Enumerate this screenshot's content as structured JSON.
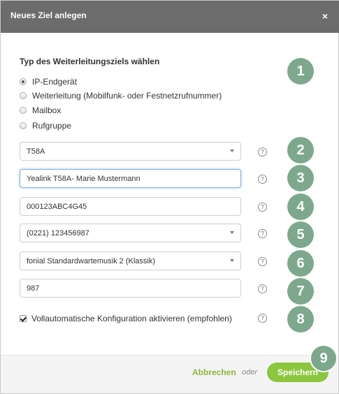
{
  "dialog": {
    "title": "Neues Ziel anlegen",
    "close_icon": "×"
  },
  "section": {
    "title": "Typ des Weiterleitungsziels wählen"
  },
  "radio_options": [
    {
      "label": "IP-Endgerät",
      "checked": true
    },
    {
      "label": "Weiterleitung (Mobilfunk- oder Festnetzrufnummer)",
      "checked": false
    },
    {
      "label": "Mailbox",
      "checked": false
    },
    {
      "label": "Rufgruppe",
      "checked": false
    }
  ],
  "fields": {
    "device_model": {
      "value": "T58A",
      "type": "select"
    },
    "device_name": {
      "value": "Yealink T58A- Marie Mustermann",
      "type": "text",
      "focused": true
    },
    "mac_address": {
      "value": "000123ABC4G45",
      "type": "text"
    },
    "phone_number": {
      "value": "(0221) 123456987",
      "type": "select"
    },
    "hold_music": {
      "value": "fonial Standardwartemusik 2 (Klassik)",
      "type": "select"
    },
    "extension": {
      "value": "987",
      "type": "text"
    }
  },
  "help_icon": "?",
  "auto_config": {
    "label": "Vollautomatische Konfiguration aktivieren (empfohlen)",
    "checked": true
  },
  "badges": [
    "1",
    "2",
    "3",
    "4",
    "5",
    "6",
    "7",
    "8",
    "9"
  ],
  "footer": {
    "cancel_label": "Abbrechen",
    "or_label": "oder",
    "save_label": "Speichern"
  },
  "colors": {
    "titlebar": "#6c6c6c",
    "badge": "#7da88d",
    "save_button": "#8cc63f",
    "cancel_link": "#8cb53a",
    "focus_border": "#7db3e8"
  },
  "icons": {
    "close": "close-icon",
    "help": "help-icon",
    "dropdown": "chevron-down-icon"
  }
}
